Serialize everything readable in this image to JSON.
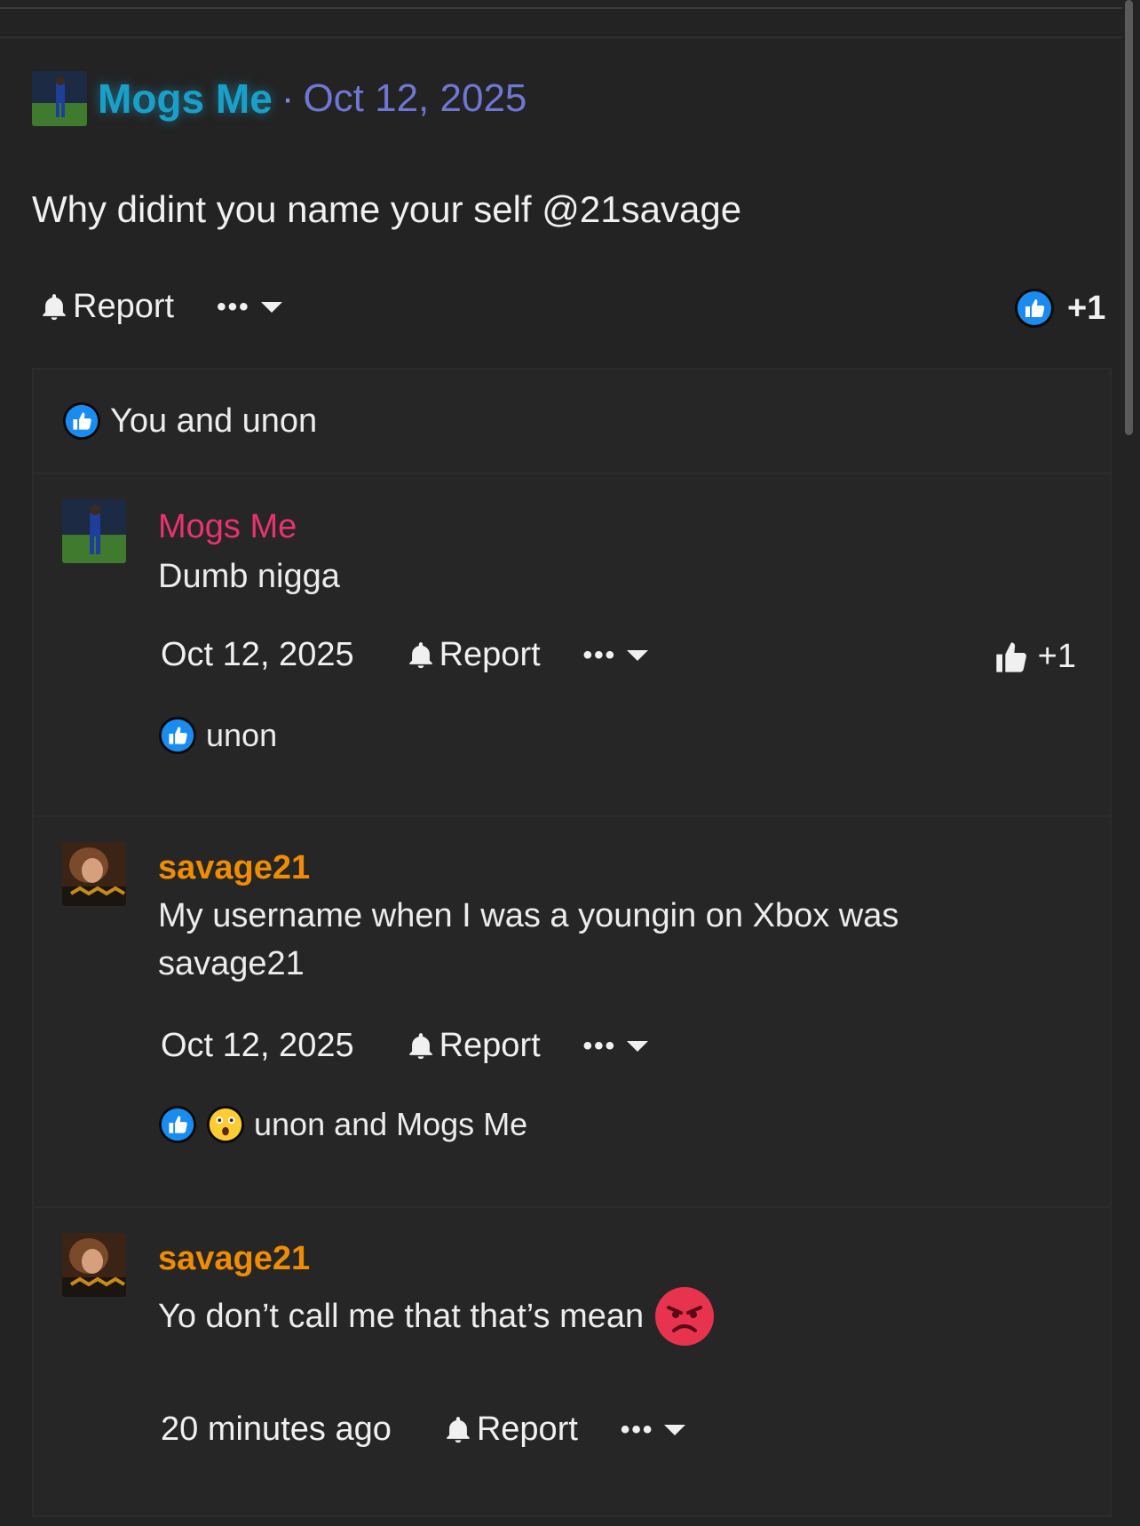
{
  "post": {
    "author": "Mogs Me",
    "separator": "·",
    "date": "Oct 12, 2025",
    "body": "Why didint you name your self @21savage",
    "report_label": "Report",
    "more_label": "•••",
    "like_count": "+1",
    "reactions_summary": "You and unon"
  },
  "comments": [
    {
      "author": "Mogs Me",
      "author_color": "#e8336f",
      "text": "Dumb nigga",
      "date": "Oct 12, 2025",
      "report_label": "Report",
      "more_label": "•••",
      "like_count": "+1",
      "reactions_text": "unon"
    },
    {
      "author": "savage21",
      "author_color": "#f08c00",
      "text": "My username when I was a youngin on Xbox was savage21",
      "date": "Oct 12, 2025",
      "report_label": "Report",
      "more_label": "•••",
      "reactions_text": "unon and Mogs Me"
    },
    {
      "author": "savage21",
      "author_color": "#f08c00",
      "text": "Yo don’t call me that that’s mean",
      "emoji": "angry-face",
      "date": "20 minutes ago",
      "report_label": "Report",
      "more_label": "•••"
    }
  ],
  "colors": {
    "background": "#232323",
    "post_author": "#1aa0c8",
    "post_date": "#6f77d4",
    "like_blue": "#1877f2"
  }
}
